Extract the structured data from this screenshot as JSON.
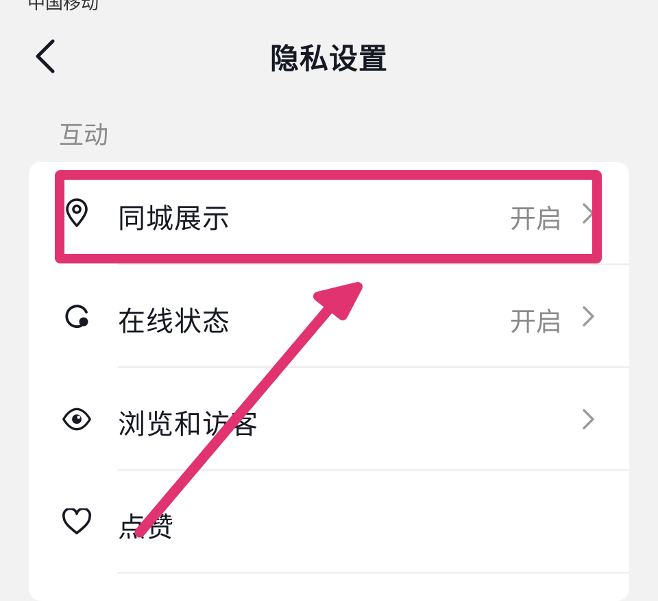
{
  "status_bar": {
    "carrier": "中国移动"
  },
  "header": {
    "title": "隐私设置",
    "back_icon": "chevron-left-icon"
  },
  "section": {
    "label": "互动"
  },
  "items": [
    {
      "label": "同城展示",
      "value": "开启",
      "icon": "location-pin-icon"
    },
    {
      "label": "在线状态",
      "value": "开启",
      "icon": "online-status-icon"
    },
    {
      "label": "浏览和访客",
      "value": "",
      "icon": "eye-icon"
    },
    {
      "label": "点赞",
      "value": "",
      "icon": "heart-icon"
    }
  ],
  "annotation": {
    "color": "#e0336f"
  },
  "colors": {
    "background": "#f2f2f2",
    "card": "#ffffff",
    "primary_text": "#161823",
    "secondary_text": "#8a8a8a"
  }
}
